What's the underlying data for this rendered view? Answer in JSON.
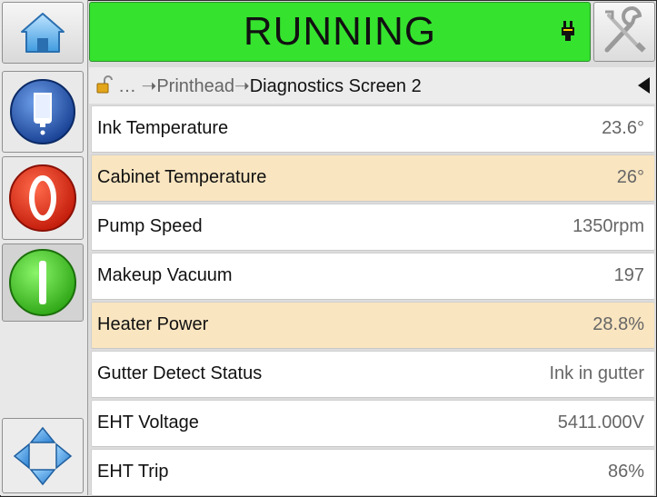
{
  "status": {
    "text": "RUNNING",
    "color": "#35e22e"
  },
  "breadcrumb": {
    "ellipsis": "…",
    "arrow": "➝",
    "parent": "Printhead",
    "current": "Diagnostics Screen 2"
  },
  "rows": [
    {
      "label": "Ink Temperature",
      "value": "23.6°",
      "highlighted": false
    },
    {
      "label": "Cabinet Temperature",
      "value": "26°",
      "highlighted": true
    },
    {
      "label": "Pump Speed",
      "value": "1350rpm",
      "highlighted": false
    },
    {
      "label": "Makeup Vacuum",
      "value": "197",
      "highlighted": false
    },
    {
      "label": "Heater Power",
      "value": "28.8%",
      "highlighted": true
    },
    {
      "label": "Gutter Detect Status",
      "value": "Ink in gutter",
      "highlighted": false
    },
    {
      "label": "EHT Voltage",
      "value": "5411.000V",
      "highlighted": false
    },
    {
      "label": "EHT Trip",
      "value": "86%",
      "highlighted": false
    }
  ],
  "icons": {
    "home": "home-icon",
    "ink": "ink-bottle-icon",
    "stop": "stop-icon",
    "start": "start-icon",
    "navigate": "navigation-arrows-icon",
    "tools": "tools-icon",
    "plug": "plug-icon",
    "lock": "unlocked-padlock-icon",
    "back": "back-arrow-icon"
  },
  "colors": {
    "highlight_row": "#f9e5c0",
    "stop_red": "#e8281c",
    "start_green": "#3fcf1f",
    "ink_blue": "#1f4fb0"
  }
}
